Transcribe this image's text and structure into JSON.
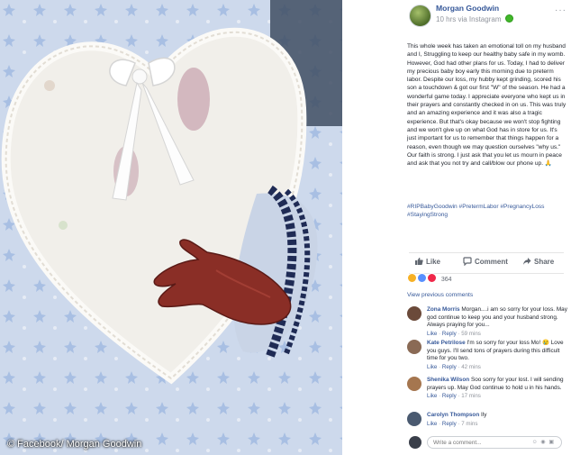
{
  "photo": {
    "caption": "© Facebook/ Morgan Goodwin"
  },
  "post": {
    "author": "Morgan Goodwin",
    "meta": "10 hrs via Instagram",
    "more": "···",
    "text": "This whole week has taken an emotional toll on my husband and I, Struggling to keep our healthy baby safe in my womb. However, God had other plans for us. Today, I had to deliver my precious baby boy early this morning due to preterm labor. Despite our loss, my hubby kept grinding, scored his son a touchdown & got our first \"W\" of the season. He had a wonderful game today. I appreciate everyone who kept us in their prayers and constantly checked in on us. This was truly and an amazing experience and it was also a tragic experience. But that's okay because we won't stop fighting and we won't give up on what God has in store for us. It's just important for us to remember that things happen for a reason, even though we may question ourselves \"why us.\" Our faith is strong. I just ask that you let us mourn in peace and ask that you not try and call/blow our phone up. 🙏",
    "hashtags": "#RIPBabyGoodwin #PretermLabor #PregnancyLoss #StayingStrong"
  },
  "actions": {
    "like": "Like",
    "comment": "Comment",
    "share": "Share"
  },
  "reactions": {
    "count": "364",
    "colors": [
      "#f7b125",
      "#5890ff",
      "#f0284a"
    ]
  },
  "view_previous": "View previous comments",
  "comments": [
    {
      "name": "Zona Morris",
      "text": "Morgan....i am so sorry for your loss. May god continue to keep you and your husband strong. Always praying for you...",
      "like": "Like",
      "reply": "Reply",
      "time": "59 mins",
      "avatar_color": "#6b4a3a"
    },
    {
      "name": "Kate Petrilose",
      "text": "I'm so sorry for your loss Mo! 😢 Love you guys. I'll send tons of prayers during this difficult time for you two.",
      "like": "Like",
      "reply": "Reply",
      "time": "42 mins",
      "avatar_color": "#8a6a55"
    },
    {
      "name": "Shenika Wilson",
      "text": "Soo sorry for your lost. I will sending prayers up. May God continue to hold u in his hands.",
      "like": "Like",
      "reply": "Reply",
      "time": "17 mins",
      "avatar_color": "#a5764f"
    },
    {
      "name": "Carolyn Thompson",
      "text": "Ily",
      "like": "Like",
      "reply": "Reply",
      "time": "7 mins",
      "avatar_color": "#4a5a70"
    }
  ],
  "write_comment": {
    "placeholder": "Write a comment..."
  }
}
